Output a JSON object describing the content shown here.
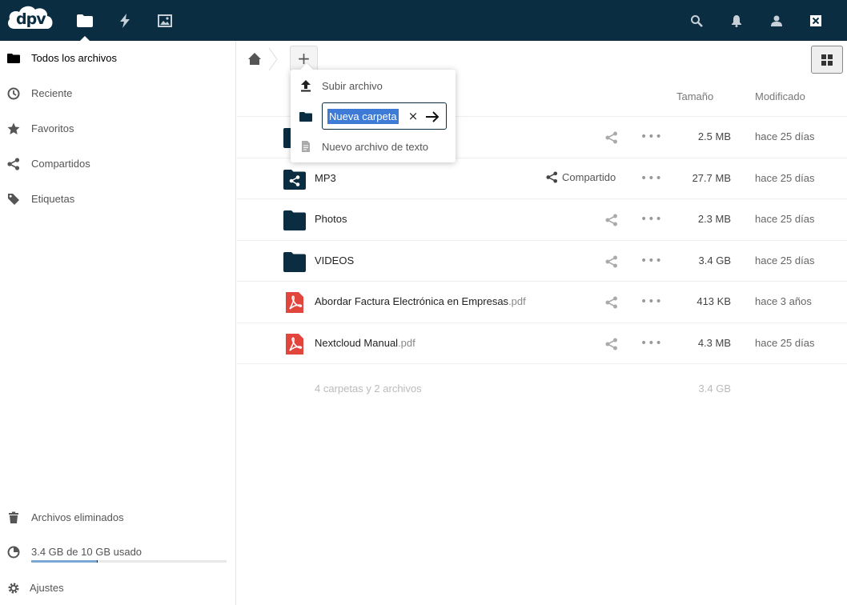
{
  "header": {
    "logo_text": "dpv",
    "apps": [
      {
        "name": "files-icon",
        "active": true
      },
      {
        "name": "activity-icon",
        "active": false
      },
      {
        "name": "gallery-icon",
        "active": false
      }
    ],
    "right_icons": [
      "search-icon",
      "notifications-icon",
      "contacts-icon",
      "user-menu-icon"
    ]
  },
  "sidebar": {
    "items": [
      {
        "label": "Todos los archivos",
        "icon": "folder-icon",
        "active": true
      },
      {
        "label": "Reciente",
        "icon": "clock-icon"
      },
      {
        "label": "Favoritos",
        "icon": "star-icon"
      },
      {
        "label": "Compartidos",
        "icon": "share-icon"
      },
      {
        "label": "Etiquetas",
        "icon": "tag-icon"
      }
    ],
    "deleted": "Archivos eliminados",
    "quota_text": "3.4 GB de 10 GB usado",
    "quota_fraction": 0.34,
    "settings": "Ajustes"
  },
  "toolbar": {
    "new_button": "+"
  },
  "popover": {
    "upload": "Subir archivo",
    "new_folder_value": "Nueva carpeta",
    "new_text_file": "Nuevo archivo de texto"
  },
  "columns": {
    "size": "Tamaño",
    "modified": "Modificado"
  },
  "files": [
    {
      "name": "",
      "ext": "",
      "type": "folder",
      "size": "2.5 MB",
      "modified": "hace 25 días",
      "shared": false
    },
    {
      "name": "MP3",
      "ext": "",
      "type": "shared-folder",
      "size": "27.7 MB",
      "modified": "hace 25 días",
      "shared": true,
      "shared_label": "Compartido"
    },
    {
      "name": "Photos",
      "ext": "",
      "type": "folder",
      "size": "2.3 MB",
      "modified": "hace 25 días",
      "shared": false
    },
    {
      "name": "VIDEOS",
      "ext": "",
      "type": "folder",
      "size": "3.4 GB",
      "modified": "hace 25 días",
      "shared": false
    },
    {
      "name": "Abordar Factura Electrónica en Empresas",
      "ext": ".pdf",
      "type": "pdf",
      "size": "413 KB",
      "modified": "hace 3 años",
      "shared": false
    },
    {
      "name": "Nextcloud Manual",
      "ext": ".pdf",
      "type": "pdf",
      "size": "4.3 MB",
      "modified": "hace 25 días",
      "shared": false
    }
  ],
  "summary": {
    "text": "4 carpetas y 2 archivos",
    "size": "3.4 GB"
  },
  "colors": {
    "header_bg": "#0a2d42",
    "folder": "#0a2d42",
    "pdf": "#e2453c",
    "selection": "#3e7bd6"
  }
}
